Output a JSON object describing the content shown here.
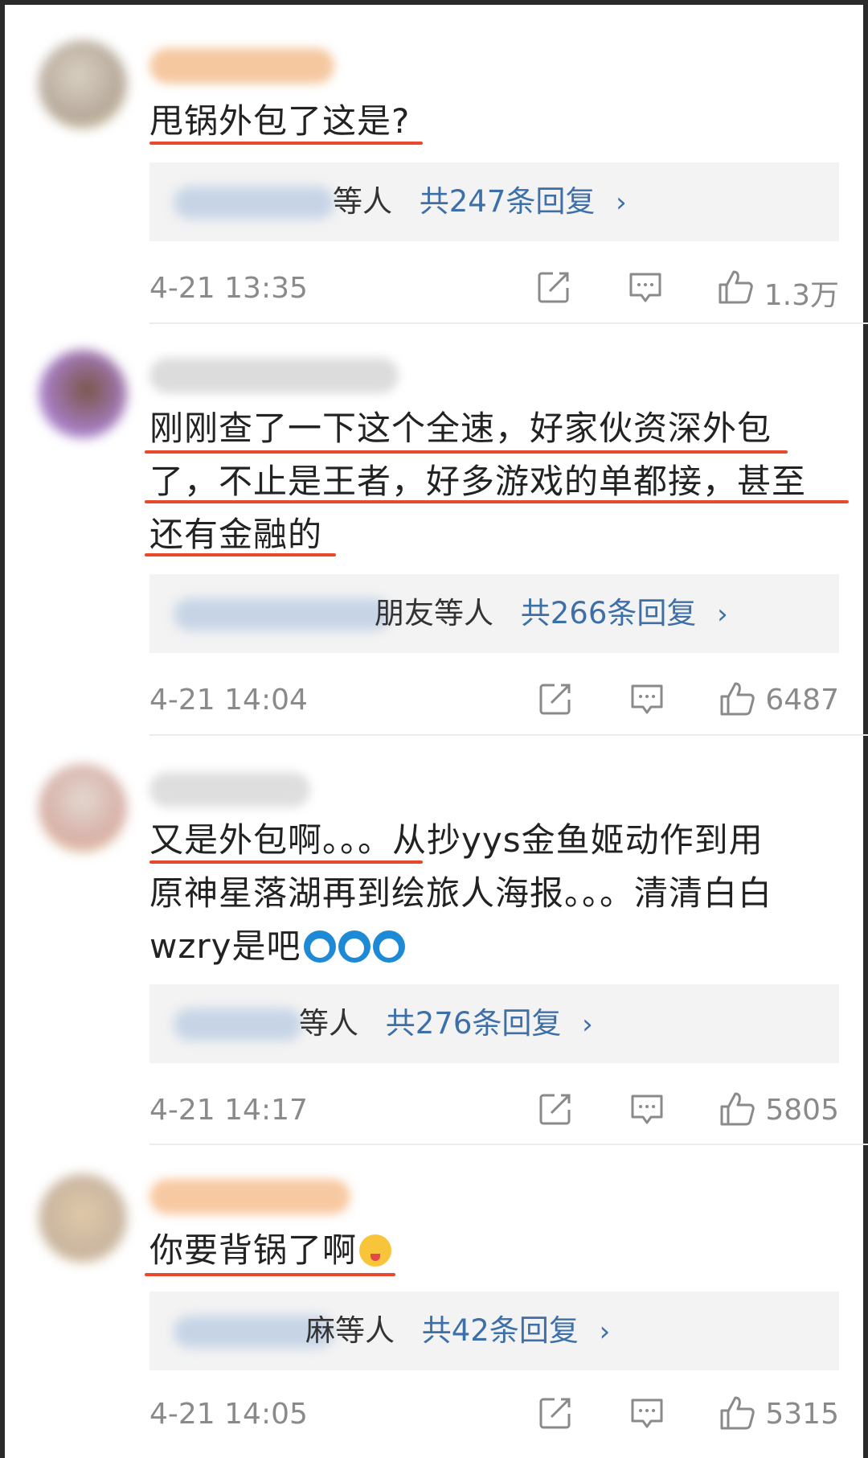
{
  "comments": [
    {
      "lines": [
        "甩锅外包了这是?"
      ],
      "reply_suffix": "等人",
      "reply_count": "共247条回复",
      "time": "4-21 13:35",
      "likes": "1.3万"
    },
    {
      "lines": [
        "刚刚查了一下这个全速，好家伙资深外包",
        "了，不止是王者，好多游戏的单都接，甚至",
        "还有金融的"
      ],
      "reply_suffix": "朋友等人",
      "reply_count": "共266条回复",
      "time": "4-21 14:04",
      "likes": "6487"
    },
    {
      "lines": [
        "又是外包啊。。。从抄yys金鱼姬动作到用",
        "原神星落湖再到绘旅人海报。。。清清白白",
        "wzry是吧"
      ],
      "reply_suffix": "等人",
      "reply_count": "共276条回复",
      "time": "4-21 14:17",
      "likes": "5805"
    },
    {
      "lines": [
        "你要背锅了啊"
      ],
      "reply_suffix": "麻等人",
      "reply_count": "共42条回复",
      "time": "4-21 14:05",
      "likes": "5315"
    }
  ],
  "reply_chevron": "›",
  "icons": {
    "share": "share-icon",
    "comment": "comment-icon",
    "like": "thumbs-up-icon",
    "emoji_doraemon": "doraemon-emoji-icon",
    "emoji_smile": "tongue-smile-emoji-icon"
  },
  "colors": {
    "reply_link": "#3d6fa8",
    "underline": "#e8492a",
    "meta_text": "#8a8a8a"
  }
}
